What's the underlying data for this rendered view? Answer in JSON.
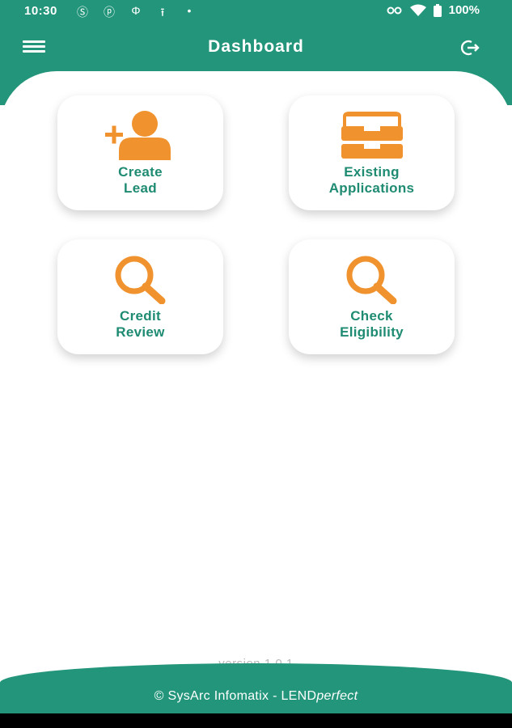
{
  "status_bar": {
    "time": "10:30",
    "battery": "100%"
  },
  "header": {
    "title": "Dashboard"
  },
  "tiles": [
    {
      "line1": "Create",
      "line2": "Lead",
      "icon": "add-person-icon"
    },
    {
      "line1": "Existing",
      "line2": "Applications",
      "icon": "inbox-tray-icon"
    },
    {
      "line1": "Credit",
      "line2": "Review",
      "icon": "search-icon"
    },
    {
      "line1": "Check",
      "line2": "Eligibility",
      "icon": "search-icon"
    }
  ],
  "version": "version 1.0.1",
  "footer": {
    "copyright": "© SysArc Infomatix - LEND",
    "brand_italic": "perfect"
  },
  "colors": {
    "primary": "#22957a",
    "accent": "#f0922e",
    "label": "#1e8b72"
  }
}
